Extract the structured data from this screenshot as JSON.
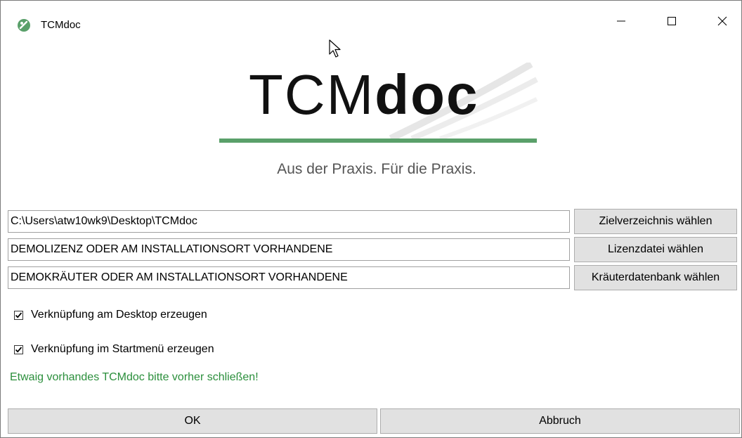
{
  "window": {
    "title": "TCMdoc",
    "controls": {
      "minimize": "minimize-icon",
      "maximize": "maximize-icon",
      "close": "close-icon"
    }
  },
  "logo": {
    "brand_light": "TCM",
    "brand_bold": "doc",
    "tagline": "Aus der Praxis. Für die Praxis.",
    "accent_color": "#5aa06a"
  },
  "fields": {
    "target_dir": "C:\\Users\\atw10wk9\\Desktop\\TCMdoc",
    "license": "DEMOLIZENZ ODER AM INSTALLATIONSORT VORHANDENE",
    "herbs_db": "DEMOKRÄUTER ODER AM INSTALLATIONSORT VORHANDENE"
  },
  "buttons": {
    "choose_target": "Zielverzeichnis wählen",
    "choose_license": "Lizenzdatei wählen",
    "choose_herbs_db": "Kräuterdatenbank wählen",
    "ok": "OK",
    "cancel": "Abbruch"
  },
  "options": {
    "desktop_shortcut": {
      "label": "Verknüpfung am Desktop erzeugen",
      "checked": true
    },
    "startmenu_shortcut": {
      "label": "Verknüpfung im Startmenü erzeugen",
      "checked": true
    }
  },
  "warning": {
    "text": "Etwaig vorhandes TCMdoc bitte vorher schließen!",
    "color": "#2b8f3c"
  }
}
